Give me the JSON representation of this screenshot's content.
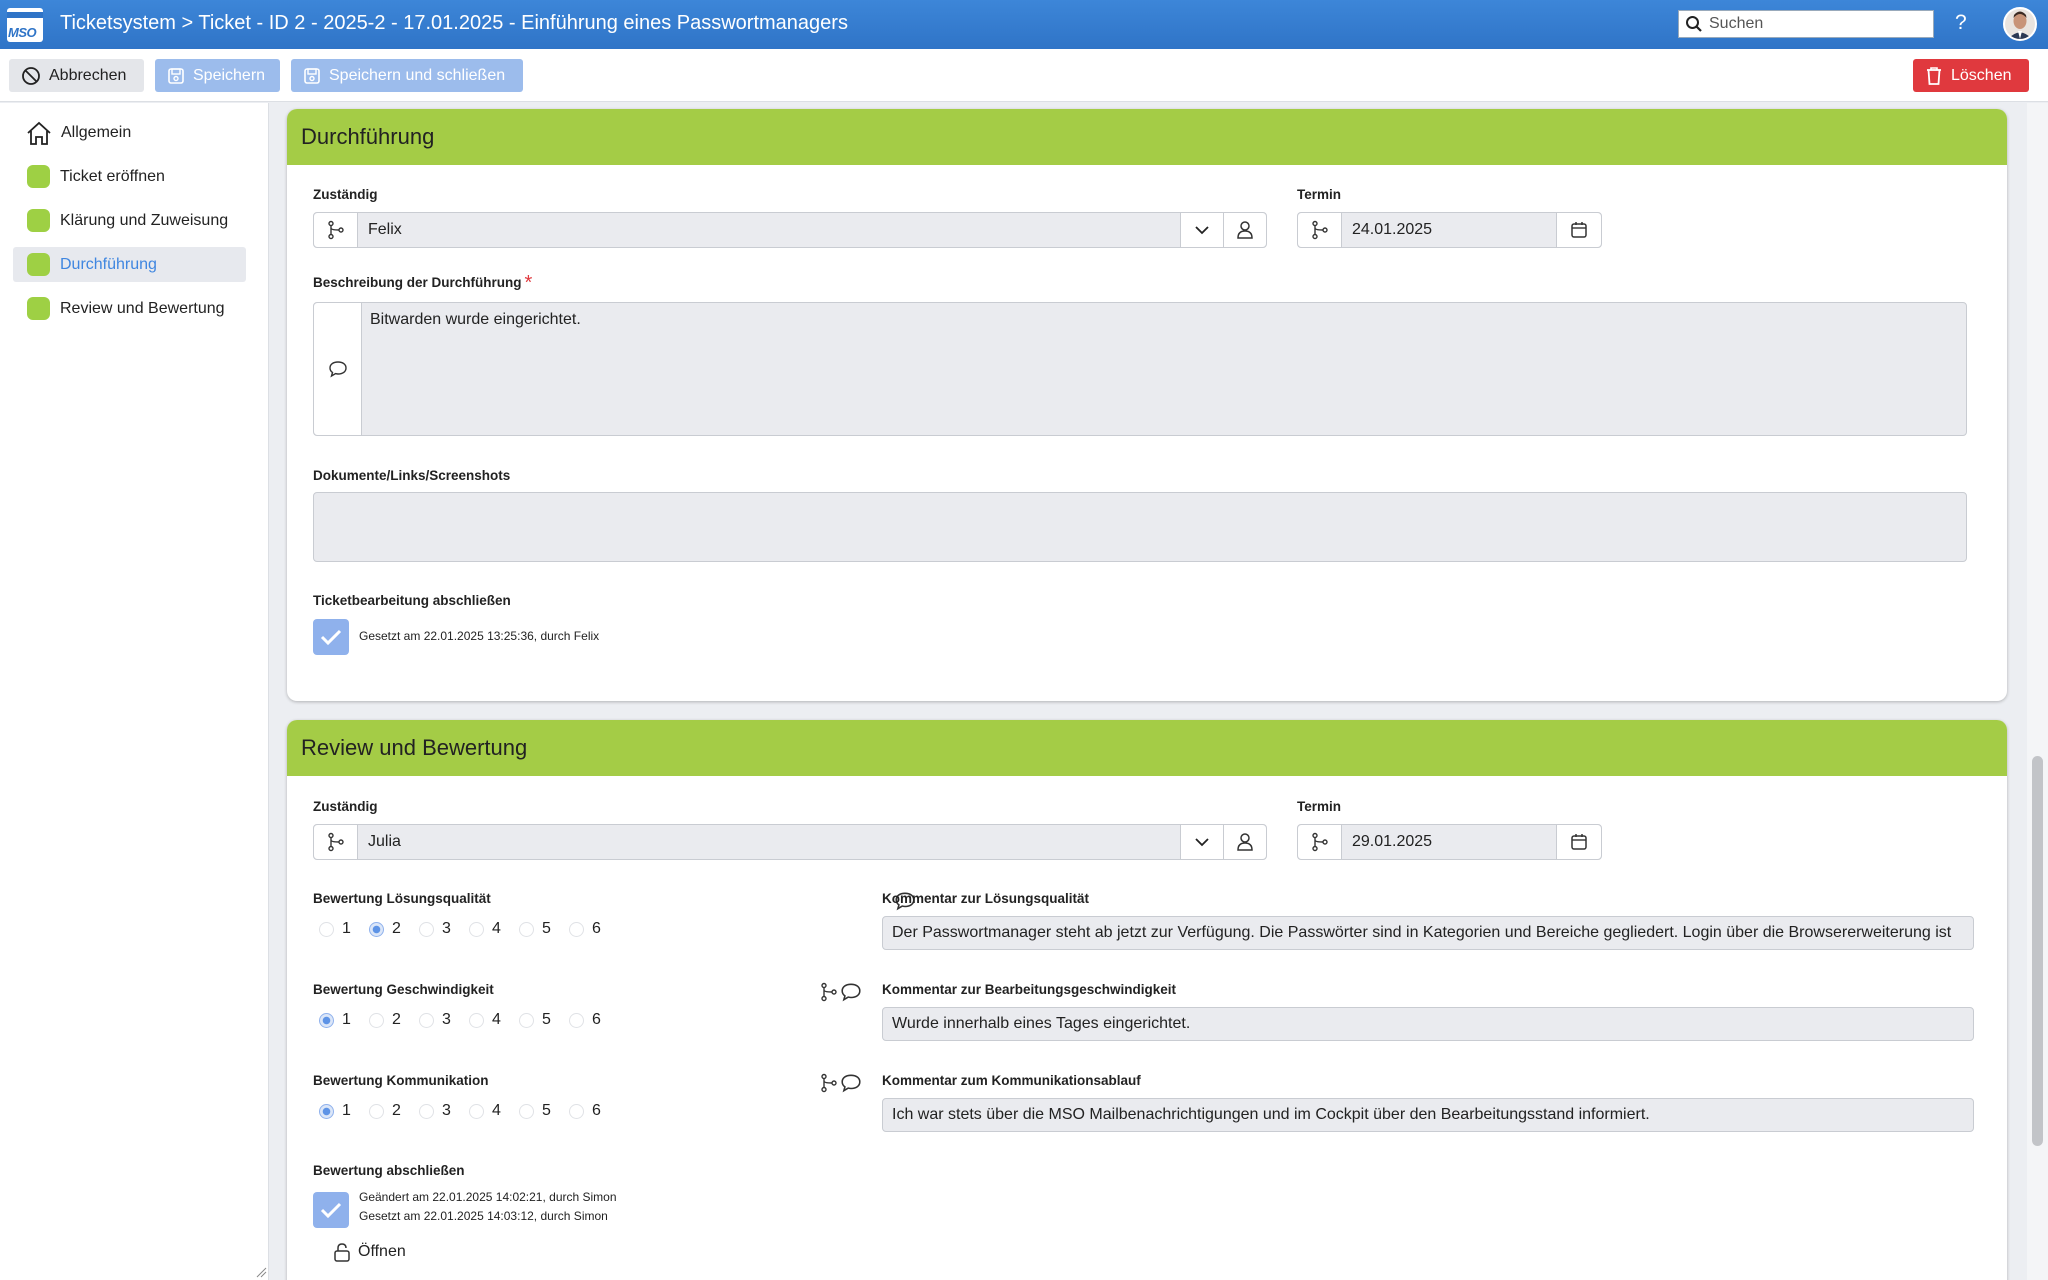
{
  "titlebar": {
    "logo_text": "MSO",
    "title": "Ticketsystem > Ticket - ID 2 - 2025-2 - 17.01.2025 - Einführung eines Passwortmanagers",
    "search_placeholder": "Suchen",
    "help": "?"
  },
  "toolbar": {
    "cancel": "Abbrechen",
    "save": "Speichern",
    "save_close": "Speichern und schließen",
    "delete": "Löschen"
  },
  "sidebar": {
    "items": [
      {
        "label": "Allgemein"
      },
      {
        "label": "Ticket eröffnen"
      },
      {
        "label": "Klärung und Zuweisung"
      },
      {
        "label": "Durchführung"
      },
      {
        "label": "Review und Bewertung"
      }
    ]
  },
  "durchfuehrung": {
    "title": "Durchführung",
    "zustaendig_label": "Zuständig",
    "zustaendig_value": "Felix",
    "termin_label": "Termin",
    "termin_value": "24.01.2025",
    "beschreibung_label": "Beschreibung der Durchführung",
    "required_mark": "*",
    "beschreibung_value": "Bitwarden wurde eingerichtet.",
    "dokumente_label": "Dokumente/Links/Screenshots",
    "abschliessen_label": "Ticketbearbeitung abschließen",
    "abschliessen_info": "Gesetzt am 22.01.2025 13:25:36, durch Felix"
  },
  "review": {
    "title": "Review und Bewertung",
    "zustaendig_label": "Zuständig",
    "zustaendig_value": "Julia",
    "termin_label": "Termin",
    "termin_value": "29.01.2025",
    "loesung_label": "Bewertung Lösungsqualität",
    "loesung_selected": 2,
    "loesung_comment_label": "Kommentar zur Lösungsqualität",
    "loesung_comment": "Der Passwortmanager steht ab jetzt zur Verfügung. Die Passwörter sind in Kategorien und Bereiche gegliedert. Login über die Browsererweiterung  ist",
    "geschw_label": "Bewertung Geschwindigkeit",
    "geschw_selected": 1,
    "geschw_comment_label": "Kommentar zur Bearbeitungsgeschwindigkeit",
    "geschw_comment": "Wurde innerhalb eines Tages eingerichtet.",
    "komm_label": "Bewertung Kommunikation",
    "komm_selected": 1,
    "komm_comment_label": "Kommentar zum Kommunikationsablauf",
    "komm_comment": "Ich war stets über die MSO Mailbenachrichtigungen und im Cockpit über den Bearbeitungsstand informiert.",
    "rating_options": [
      "1",
      "2",
      "3",
      "4",
      "5",
      "6"
    ],
    "abschliessen_label": "Bewertung abschließen",
    "abschliessen_info1": "Geändert am 22.01.2025 14:02:21, durch Simon",
    "abschliessen_info2": "Gesetzt am 22.01.2025 14:03:12, durch Simon",
    "open_label": "Öffnen"
  },
  "colors": {
    "accent": "#3f86e0",
    "section_header": "#a4cc46",
    "delete": "#e0393e"
  }
}
